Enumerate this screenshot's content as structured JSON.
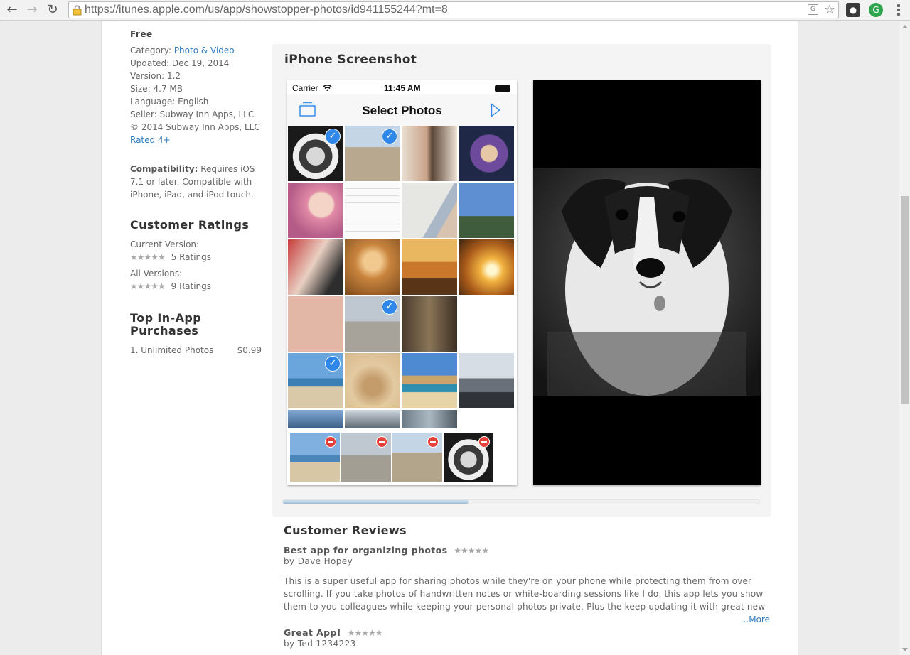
{
  "browser": {
    "url": "https://itunes.apple.com/us/app/showstopper-photos/id941155244?mt=8",
    "colors": {
      "extension_green": "#2ea44f",
      "extension_dark": "#3a3a3a"
    }
  },
  "app_info": {
    "price": "Free",
    "category_label": "Category:",
    "category_value": "Photo & Video",
    "updated": "Updated: Dec 19, 2014",
    "version": "Version: 1.2",
    "size": "Size: 4.7 MB",
    "language": "Language: English",
    "seller": "Seller: Subway Inn Apps, LLC",
    "copyright": "© 2014 Subway Inn Apps, LLC",
    "rated": "Rated 4+",
    "compat_label": "Compatibility:",
    "compat_text": "Requires iOS 7.1 or later. Compatible with iPhone, iPad, and iPod touch."
  },
  "ratings": {
    "heading": "Customer Ratings",
    "current_label": "Current Version:",
    "current_stars": "★★★★★",
    "current_count": "5 Ratings",
    "all_label": "All Versions:",
    "all_stars": "★★★★★",
    "all_count": "9 Ratings"
  },
  "iap": {
    "heading": "Top In-App Purchases",
    "items": [
      {
        "name": "1. Unlimited Photos",
        "price": "$0.99"
      }
    ]
  },
  "screenshots": {
    "heading": "iPhone Screenshot",
    "phone": {
      "carrier": "Carrier",
      "time": "11:45 AM",
      "title": "Select Photos",
      "accent": "#2f87ea"
    }
  },
  "reviews": {
    "heading": "Customer Reviews",
    "items": [
      {
        "title": "Best app for organizing photos",
        "stars": "★★★★★",
        "author": "by Dave Hopey",
        "body": "This is a super useful app for sharing photos while they're on your phone while protecting them from over scrolling. If you take photos of handwritten notes or white-boarding sessions like I do, this app lets you show them to you colleagues while keeping your personal photos private. Plus the keep updating it with great new features like locked",
        "more": "...More"
      },
      {
        "title": "Great App!",
        "stars": "★★★★★",
        "author": "by Ted 1234223"
      }
    ]
  }
}
